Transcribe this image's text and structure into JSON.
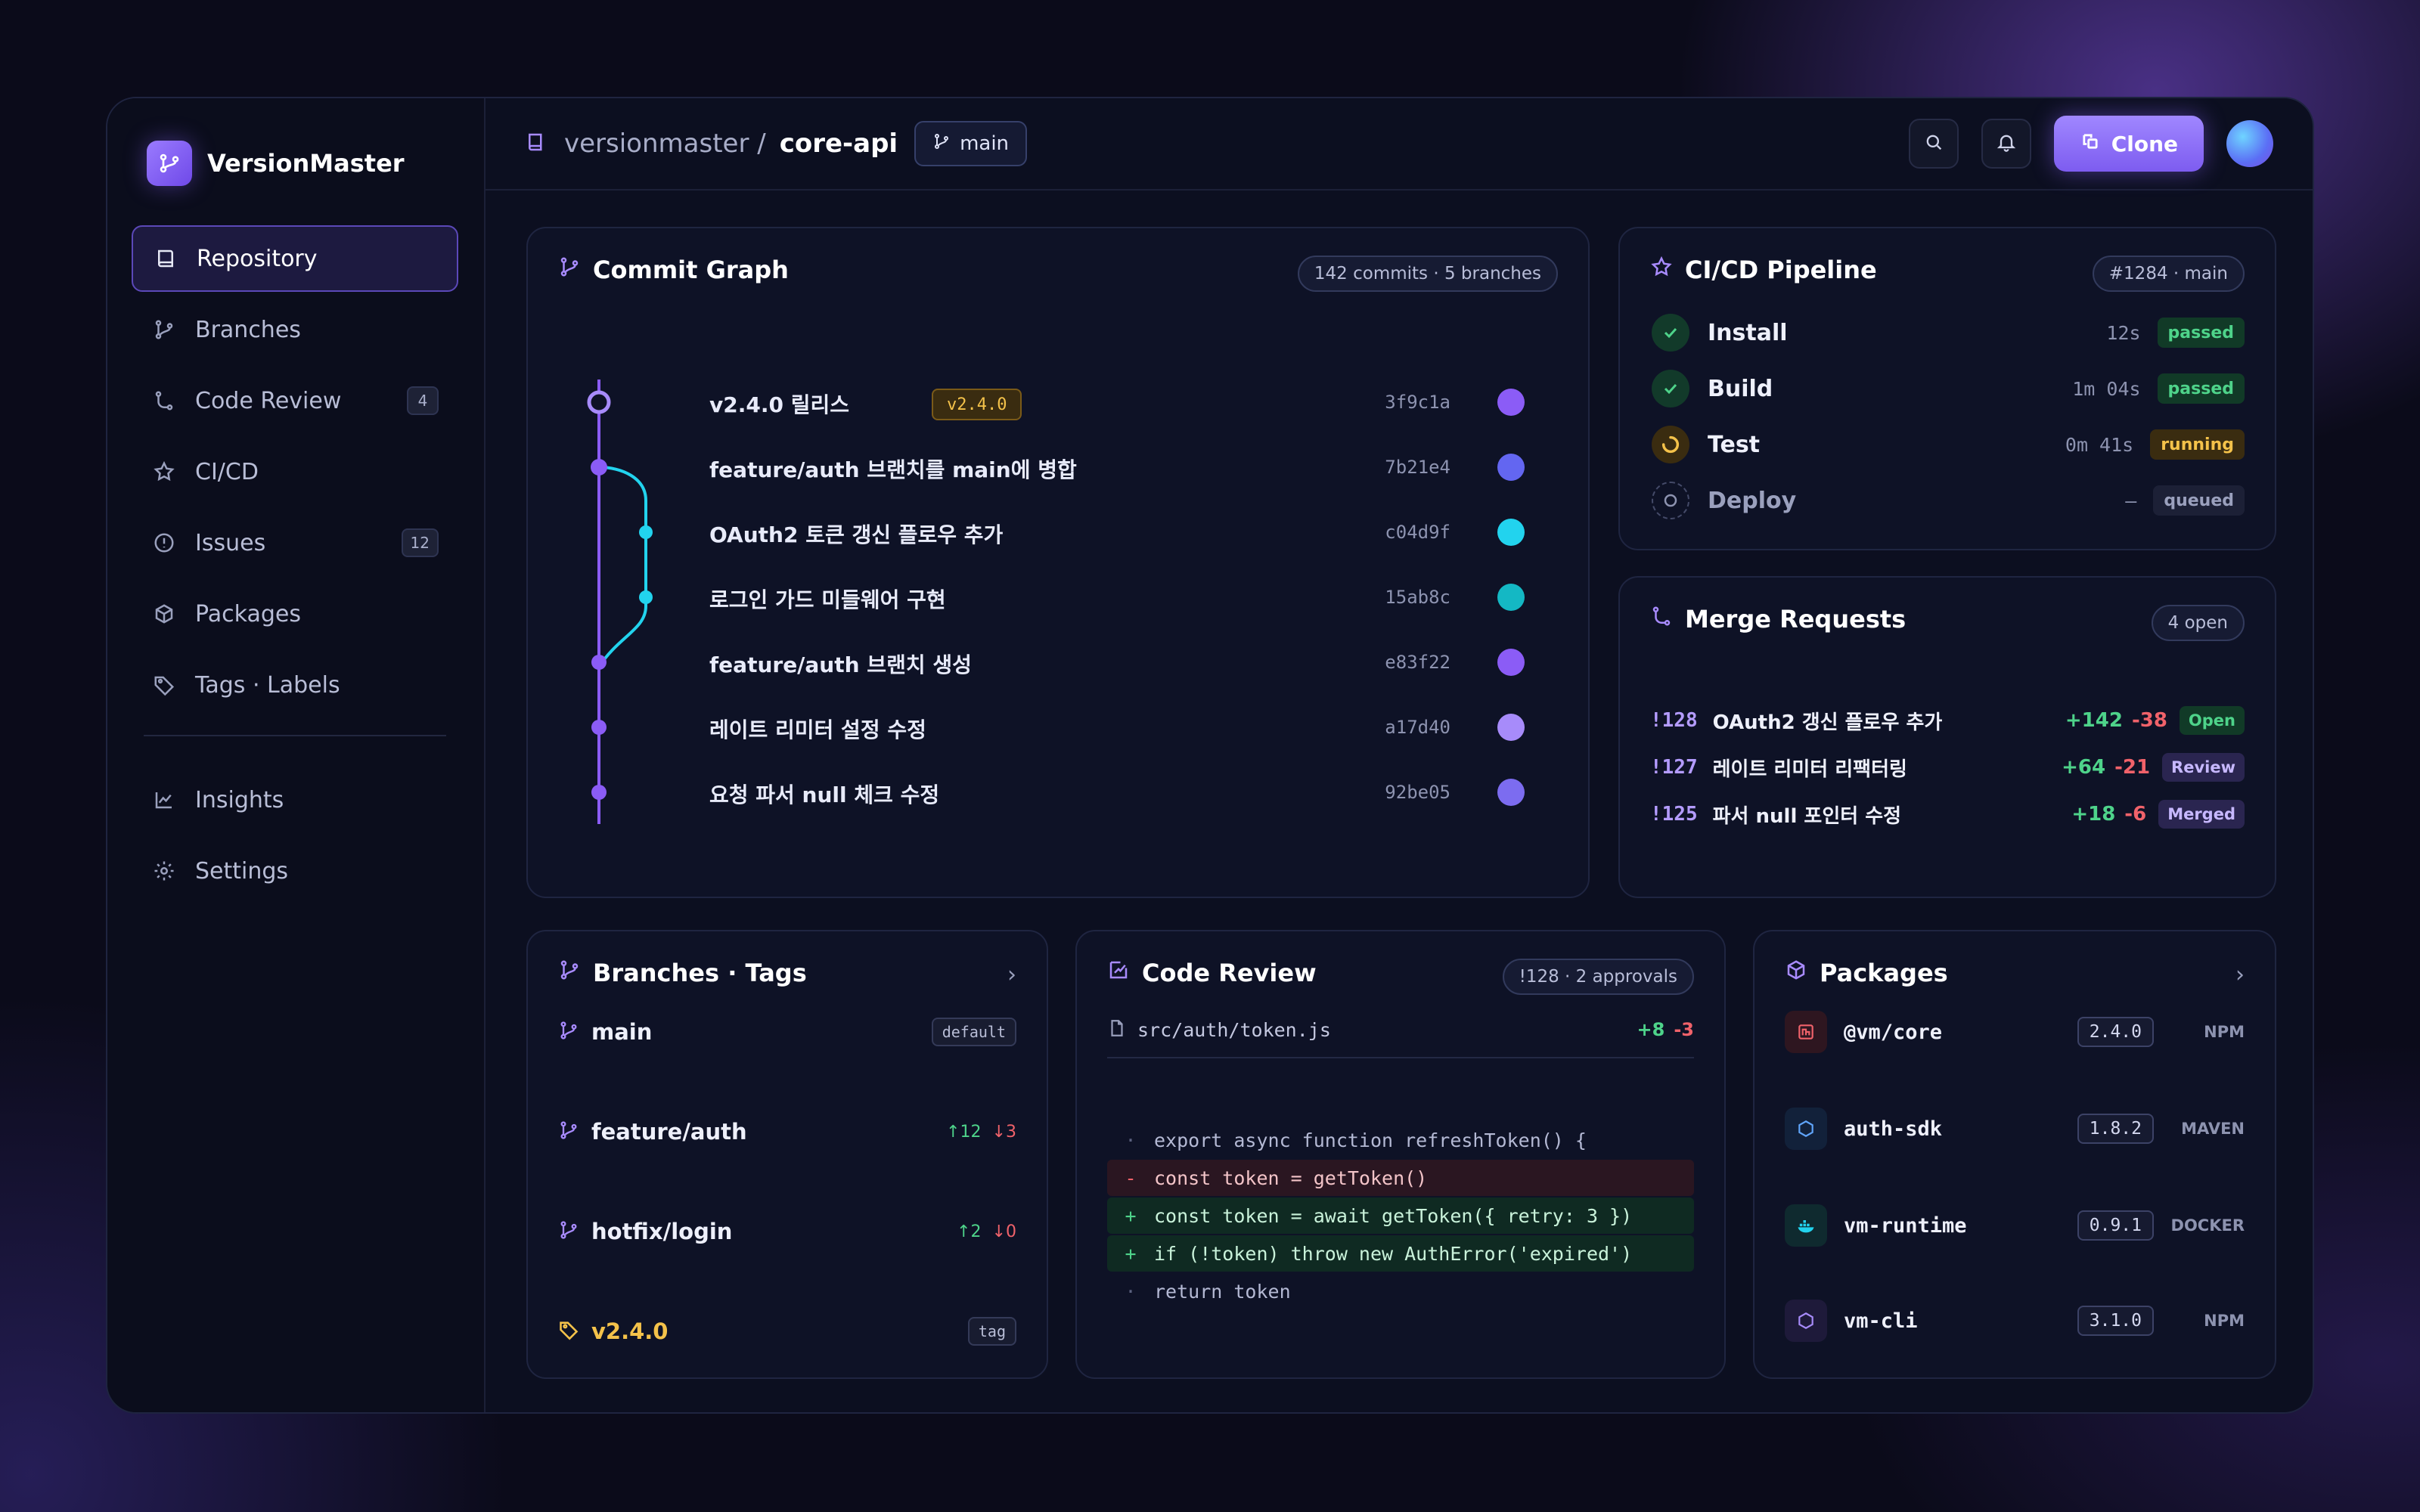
{
  "brand": {
    "name": "VersionMaster"
  },
  "sidebar": {
    "items": [
      {
        "label": "Repository"
      },
      {
        "label": "Branches"
      },
      {
        "label": "Code Review",
        "count": "4"
      },
      {
        "label": "CI/CD"
      },
      {
        "label": "Issues",
        "count": "12"
      },
      {
        "label": "Packages"
      },
      {
        "label": "Tags · Labels"
      }
    ],
    "bottom": [
      {
        "label": "Insights"
      },
      {
        "label": "Settings"
      }
    ]
  },
  "header": {
    "org": "versionmaster /",
    "repo": "core-api",
    "branch": "main",
    "clone_label": "Clone"
  },
  "commit_graph": {
    "title": "Commit Graph",
    "summary": "142 commits · 5 branches",
    "commits": [
      {
        "message": "v2.4.0 릴리스",
        "tag": "v2.4.0",
        "hash": "3f9c1a",
        "color": "#8b5cf6"
      },
      {
        "message": "feature/auth 브랜치를 main에 병합",
        "hash": "7b21e4",
        "color": "#6366f1"
      },
      {
        "message": "OAuth2 토큰 갱신 플로우 추가",
        "hash": "c04d9f",
        "color": "#22d3ee"
      },
      {
        "message": "로그인 가드 미들웨어 구현",
        "hash": "15ab8c",
        "color": "#14b8c4"
      },
      {
        "message": "feature/auth 브랜치 생성",
        "hash": "e83f22",
        "color": "#8b5cf6"
      },
      {
        "message": "레이트 리미터 설정 수정",
        "hash": "a17d40",
        "color": "#a78bfa"
      },
      {
        "message": "요청 파서 null 체크 수정",
        "hash": "92be05",
        "color": "#7c6cf0"
      }
    ]
  },
  "pipeline": {
    "title": "CI/CD Pipeline",
    "run": "#1284 · main",
    "steps": [
      {
        "name": "Install",
        "time": "12s",
        "status": "passed"
      },
      {
        "name": "Build",
        "time": "1m 04s",
        "status": "passed"
      },
      {
        "name": "Test",
        "time": "0m 41s",
        "status": "running"
      },
      {
        "name": "Deploy",
        "time": "—",
        "status": "queued"
      }
    ]
  },
  "merge_requests": {
    "title": "Merge Requests",
    "open": "4 open",
    "items": [
      {
        "id": "!128",
        "title": "OAuth2 갱신 플로우 추가",
        "add": "+142",
        "del": "-38",
        "status": "Open"
      },
      {
        "id": "!127",
        "title": "레이트 리미터 리팩터링",
        "add": "+64",
        "del": "-21",
        "status": "Review"
      },
      {
        "id": "!125",
        "title": "파서 null 포인터 수정",
        "add": "+18",
        "del": "-6",
        "status": "Merged"
      }
    ]
  },
  "branches": {
    "title": "Branches · Tags",
    "items": [
      {
        "name": "main",
        "badge": "default"
      },
      {
        "name": "feature/auth",
        "ahead": "↑12",
        "behind": "↓3"
      },
      {
        "name": "hotfix/login",
        "ahead": "↑2",
        "behind": "↓0"
      },
      {
        "name": "v2.4.0",
        "badge": "tag"
      }
    ]
  },
  "code_review": {
    "title": "Code Review",
    "meta": "!128 · 2 approvals",
    "file": "src/auth/token.js",
    "add": "+8",
    "del": "-3",
    "lines": [
      {
        "prefix": "·",
        "code": "export async function refreshToken() {",
        "kind": "ctx"
      },
      {
        "prefix": "-",
        "code": "const token = getToken()",
        "kind": "del"
      },
      {
        "prefix": "+",
        "code": "const token = await getToken({ retry: 3 })",
        "kind": "add"
      },
      {
        "prefix": "+",
        "code": "if (!token) throw new AuthError('expired')",
        "kind": "add"
      },
      {
        "prefix": "·",
        "code": "return token",
        "kind": "ctx"
      }
    ]
  },
  "packages": {
    "title": "Packages",
    "items": [
      {
        "name": "@vm/core",
        "version": "2.4.0",
        "type": "NPM",
        "icon": "npm-icon"
      },
      {
        "name": "auth-sdk",
        "version": "1.8.2",
        "type": "MAVEN",
        "icon": "hexagon-icon"
      },
      {
        "name": "vm-runtime",
        "version": "0.9.1",
        "type": "DOCKER",
        "icon": "docker-icon"
      },
      {
        "name": "vm-cli",
        "version": "3.1.0",
        "type": "NPM",
        "icon": "hexagon-icon"
      }
    ]
  },
  "colors": {
    "accent": "#8b5cf6",
    "passed": "#4ed38a",
    "running": "#f4c24a",
    "deleted": "#f0626a"
  }
}
